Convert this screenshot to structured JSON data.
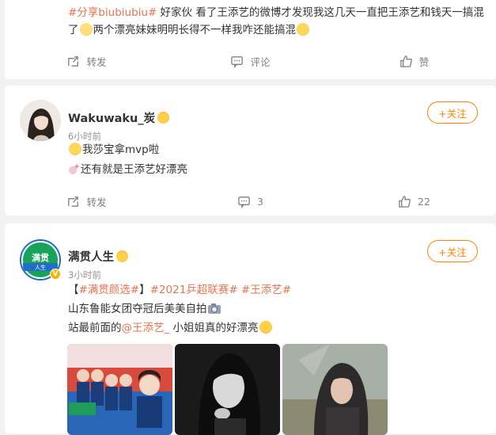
{
  "post1": {
    "line1_tag": "#分享biubiubiu#",
    "line1_text": " 好家伙 看了王添艺的微博才发现我这几天一直把王添艺和钱天一搞混",
    "line2_a": "了",
    "line2_b": "两个漂亮妹妹明明长得不一样我咋还能搞混",
    "actions": {
      "repost": "转发",
      "comment": "评论",
      "like": "赞"
    }
  },
  "post2": {
    "username": "Wakuwaku_炭",
    "time": "6小时前",
    "follow_label": "+关注",
    "line1": "我莎宝拿mvp啦",
    "line2": "还有就是王添艺好漂亮",
    "actions": {
      "repost": "转发",
      "comment": "3",
      "like": "22"
    }
  },
  "post3": {
    "username": "满贯人生",
    "avatar_text": "满贯",
    "avatar_sub": "人生",
    "time": "3小时前",
    "follow_label": "+关注",
    "line1_open": "【",
    "tag1": "#满贯颜选#",
    "close": "】",
    "tag2": "#2021乒超联赛#",
    "tag3": "#王添艺#",
    "line2": "山东鲁能女团夺冠后美美自拍",
    "line3_a": "站最前面的",
    "mention": "@王添艺_",
    "line3_b": " 小姐姐真的好漂亮"
  },
  "colors": {
    "accent": "#ff8200",
    "link": "#eb7350",
    "vip": "#f7b500"
  }
}
